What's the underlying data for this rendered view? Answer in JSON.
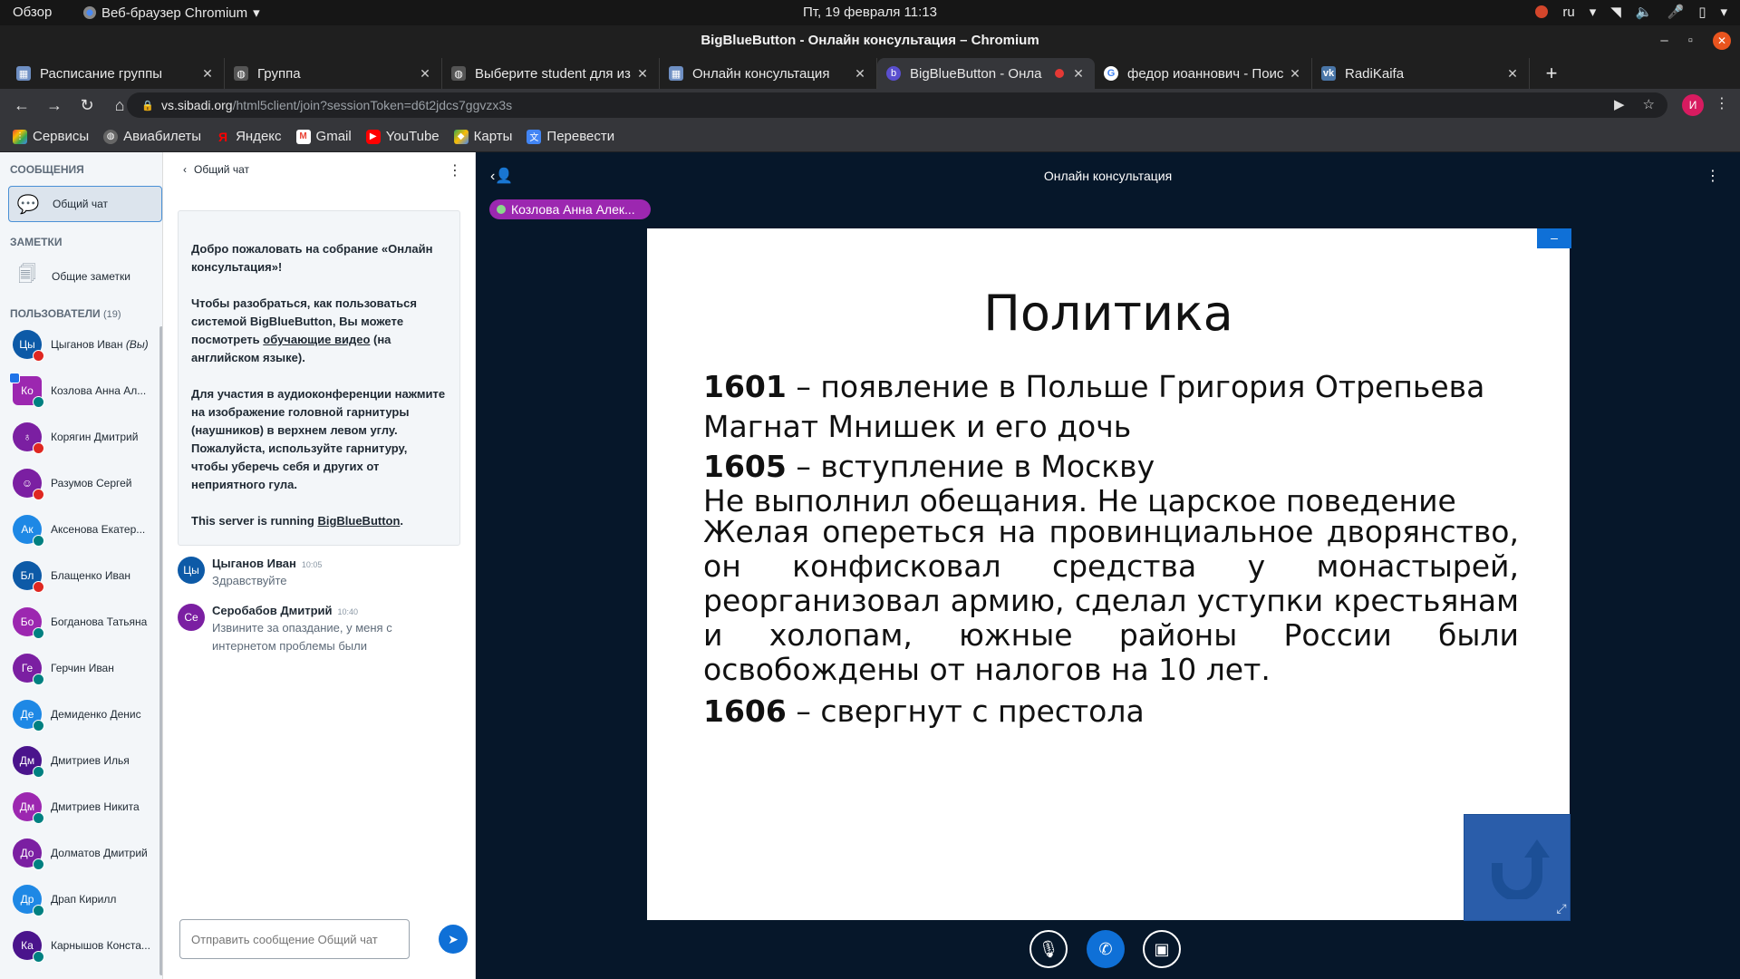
{
  "gnome": {
    "activities": "Обзор",
    "app": "Веб-браузер Chromium",
    "clock": "Пт, 19 февраля  11:13",
    "lang": "ru"
  },
  "window": {
    "title": "BigBlueButton - Онлайн консультация – Chromium"
  },
  "tabs": [
    {
      "label": "Расписание группы",
      "icon": "schedule-icon",
      "color": "#6e8fc3"
    },
    {
      "label": "Группа",
      "icon": "globe-icon",
      "color": "#555"
    },
    {
      "label": "Выберите student для из",
      "icon": "globe-icon",
      "color": "#555"
    },
    {
      "label": "Онлайн консультация",
      "icon": "schedule-icon",
      "color": "#6e8fc3"
    },
    {
      "label": "BigBlueButton - Онла",
      "icon": "bbb-icon",
      "color": "#5a4fcf"
    },
    {
      "label": "федор иоаннович - Поис",
      "icon": "google-icon",
      "color": "#4285f4"
    },
    {
      "label": "RadiKaifa",
      "icon": "vk-icon",
      "color": "#4a76a8"
    }
  ],
  "address": {
    "host": "vs.sibadi.org",
    "path": "/html5client/join?sessionToken=d6t2jdcs7ggvzx3s",
    "profile_initial": "И"
  },
  "bookmarks": [
    {
      "label": "Сервисы",
      "icon": "apps-grid-icon",
      "color": "#ea4335"
    },
    {
      "label": "Авиабилеты",
      "icon": "globe-icon",
      "color": "#666"
    },
    {
      "label": "Яндекс",
      "icon": "yandex-icon",
      "color": "#ff0000"
    },
    {
      "label": "Gmail",
      "icon": "gmail-icon",
      "color": "#ea4335"
    },
    {
      "label": "YouTube",
      "icon": "youtube-icon",
      "color": "#ff0000"
    },
    {
      "label": "Карты",
      "icon": "maps-icon",
      "color": "#34a853"
    },
    {
      "label": "Перевести",
      "icon": "translate-icon",
      "color": "#4285f4"
    }
  ],
  "sidebar": {
    "messages_heading": "СООБЩЕНИЯ",
    "public_chat": "Общий чат",
    "notes_heading": "ЗАМЕТКИ",
    "shared_notes": "Общие заметки",
    "users_heading": "ПОЛЬЗОВАТЕЛИ",
    "users_count": "(19)",
    "users": [
      {
        "initials": "Цы",
        "name": "Цыганов Иван",
        "you": "(Вы)",
        "color": "#0d5aa7",
        "status": "muted",
        "presenter": false,
        "square": false
      },
      {
        "initials": "Ко",
        "name": "Козлова Анна Ал...",
        "you": "",
        "color": "#9c27b0",
        "status": "listen",
        "presenter": true,
        "square": true
      },
      {
        "initials": "♁",
        "name": "Корягин Дмитрий",
        "you": "",
        "color": "#7b1fa2",
        "status": "muted",
        "presenter": false,
        "square": false
      },
      {
        "initials": "☺",
        "name": "Разумов Сергей",
        "you": "",
        "color": "#7b1fa2",
        "status": "muted",
        "presenter": false,
        "square": false
      },
      {
        "initials": "Ак",
        "name": "Аксенова Екатер...",
        "you": "",
        "color": "#1e88e5",
        "status": "listen",
        "presenter": false,
        "square": false
      },
      {
        "initials": "Бл",
        "name": "Блащенко Иван",
        "you": "",
        "color": "#0d5aa7",
        "status": "muted",
        "presenter": false,
        "square": false
      },
      {
        "initials": "Бо",
        "name": "Богданова Татьяна",
        "you": "",
        "color": "#9c27b0",
        "status": "listen",
        "presenter": false,
        "square": false
      },
      {
        "initials": "Ге",
        "name": "Герчин Иван",
        "you": "",
        "color": "#7b1fa2",
        "status": "listen",
        "presenter": false,
        "square": false
      },
      {
        "initials": "Де",
        "name": "Демиденко Денис",
        "you": "",
        "color": "#1e88e5",
        "status": "listen",
        "presenter": false,
        "square": false
      },
      {
        "initials": "Дм",
        "name": "Дмитриев Илья",
        "you": "",
        "color": "#4a148c",
        "status": "listen",
        "presenter": false,
        "square": false
      },
      {
        "initials": "Дм",
        "name": "Дмитриев Никита",
        "you": "",
        "color": "#9c27b0",
        "status": "listen",
        "presenter": false,
        "square": false
      },
      {
        "initials": "До",
        "name": "Долматов Дмитрий",
        "you": "",
        "color": "#7b1fa2",
        "status": "listen",
        "presenter": false,
        "square": false
      },
      {
        "initials": "Др",
        "name": "Драп Кирилл",
        "you": "",
        "color": "#1e88e5",
        "status": "listen",
        "presenter": false,
        "square": false
      },
      {
        "initials": "Ка",
        "name": "Карнышов Конста...",
        "you": "",
        "color": "#4a148c",
        "status": "listen",
        "presenter": false,
        "square": false
      }
    ]
  },
  "chat": {
    "header": "Общий чат",
    "welcome": {
      "p1": "Добро пожаловать на собрание «Онлайн консультация»!",
      "p2a": "Чтобы разобраться, как пользоваться системой BigBlueButton, Вы можете посмотреть ",
      "p2link": "обучающие видео",
      "p2b": " (на английском языке).",
      "p3": "Для участия в аудиоконференции нажмите на изображение головной гарнитуры (наушников) в верхнем левом углу. Пожалуйста, используйте гарнитуру, чтобы уберечь себя и других от неприятного гула.",
      "p4a": "This server is running ",
      "p4link": "BigBlueButton",
      "p4b": "."
    },
    "messages": [
      {
        "initials": "Цы",
        "author": "Цыганов Иван",
        "time": "10:05",
        "text": "Здравствуйте",
        "color": "#0d5aa7"
      },
      {
        "initials": "Се",
        "author": "Серобабов Дмитрий",
        "time": "10:40",
        "text": "Извините за опаздание, у меня с интернетом проблемы были",
        "color": "#7b1fa2"
      }
    ],
    "input_placeholder": "Отправить сообщение Общий чат"
  },
  "presentation": {
    "meeting_title": "Онлайн консультация",
    "talking": "Козлова Анна Алек...",
    "slide": {
      "heading": "Политика",
      "l1_year": "1601",
      "l1_text": " – появление в Польше Григория Отрепьева",
      "l2": "Магнат Мнишек и его дочь",
      "l3_year": "1605",
      "l3_text": " – вступление в Москву",
      "l4": "Не выполнил обещания. Не царское поведение",
      "l5": "Желая опереться на провинциальное дворянство, он конфисковал средства у монастырей, реорганизовал армию, сделал уступки крестьянам и холопам, южные районы России были освобождены от налогов на 10 лет.",
      "l6_year": "1606",
      "l6_text": " – свергнут с престола"
    }
  }
}
